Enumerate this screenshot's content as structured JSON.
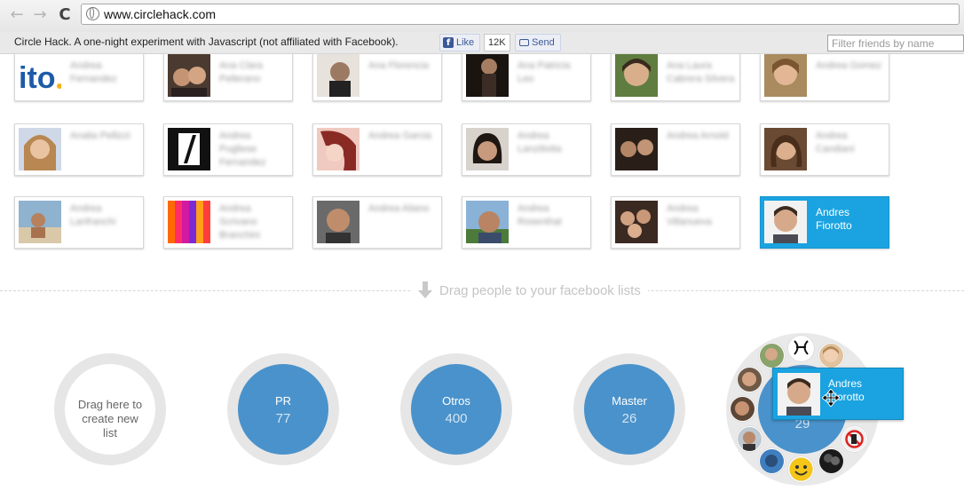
{
  "browser": {
    "url": "www.circlehack.com",
    "back_glyph": "←",
    "forward_glyph": "→",
    "reload_glyph": "C"
  },
  "toolbar": {
    "title": "Circle Hack. A one-night experiment with Javascript (not affiliated with Facebook).",
    "fb_glyph": "f",
    "like_label": "Like",
    "like_count": "12K",
    "send_label": "Send",
    "filter_placeholder": "Filter friends by name"
  },
  "friends": {
    "row1": [
      {
        "name": "Andrea Fernandez"
      },
      {
        "name": "Ana Clara Pellerano"
      },
      {
        "name": "Ana Florencia"
      },
      {
        "name": "Ana Patricia Leo"
      },
      {
        "name": "Ana Laura Cabrera Silvera"
      },
      {
        "name": "Andrea Gomez"
      }
    ],
    "row2": [
      {
        "name": "Analia Pellizzi"
      },
      {
        "name": "Andrea Pugliese Fernandez"
      },
      {
        "name": "Andrea Garcia"
      },
      {
        "name": "Andrea Lanziliotta"
      },
      {
        "name": "Andrea Arnold"
      },
      {
        "name": "Andrea Candiani"
      }
    ],
    "row3": [
      {
        "name": "Andrea Lanfranchi"
      },
      {
        "name": "Andrea Scrivano Branchini"
      },
      {
        "name": "Andrea Aliano"
      },
      {
        "name": "Andrea Rosenthal"
      },
      {
        "name": "Andrea Villanueva"
      },
      {
        "name": "Andres Fiorotto"
      }
    ]
  },
  "divider_label": "Drag people to your facebook lists",
  "circles": {
    "new_list": "Drag here to create new list",
    "list1": {
      "name": "PR",
      "count": "77"
    },
    "list2": {
      "name": "Otros",
      "count": "400"
    },
    "list3": {
      "name": "Master",
      "count": "26"
    },
    "list4": {
      "count": "29"
    }
  },
  "drag": {
    "name": "Andres Fiorotto"
  },
  "colors": {
    "selected_card": "#1aa3e0",
    "circle_fill": "#4a92cb",
    "circle_ring": "#e6e6e6"
  }
}
